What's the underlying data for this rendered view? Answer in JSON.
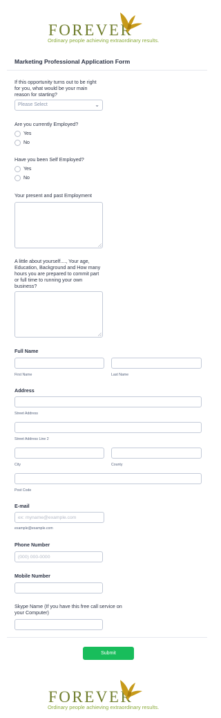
{
  "header_logo": {
    "wordmark": "FOREVER",
    "tagline": "Ordinary people achieving extraordinary results."
  },
  "form_title": "Marketing Professional Application Form",
  "q_opportunity": {
    "label": "If this opportunity turns out to be right for you, what would be your main reason for starting?",
    "value": "Please Select"
  },
  "q_employed": {
    "label": "Are you currently Employed?",
    "options": [
      "Yes",
      "No"
    ]
  },
  "q_self_employed": {
    "label": "Have you been Self Employed?",
    "options": [
      "Yes",
      "No"
    ]
  },
  "q_employment": {
    "label": "Your present and past Employment"
  },
  "q_about": {
    "label": "A little about yourself...., Your age, Education, Background and How many hours you are prepared to commit part or full time to running your own business?"
  },
  "full_name": {
    "label": "Full Name",
    "first_sub": "First Name",
    "last_sub": "Last Name"
  },
  "address": {
    "label": "Address",
    "street_sub": "Street Address",
    "street2_sub": "Street Address Line 2",
    "city_sub": "City",
    "county_sub": "County",
    "post_sub": "Post Code"
  },
  "email": {
    "label": "E-mail",
    "placeholder": "ex: myname@example.com",
    "sub": "example@example.com"
  },
  "phone": {
    "label": "Phone Number",
    "placeholder": "(000) 000-0000"
  },
  "mobile": {
    "label": "Mobile Number"
  },
  "skype": {
    "label": "Skype Name (If you have this free call service on your Computer)"
  },
  "submit_label": "Submit",
  "footer_logo": {
    "wordmark": "FOREVER",
    "tagline": "Ordinary people achieving extraordinary results."
  },
  "colors": {
    "brand_olive": "#6f7d2c",
    "tagline_green": "#8aab3a",
    "eagle_gold": "#c79a1a",
    "submit_green": "#18bd5b"
  }
}
